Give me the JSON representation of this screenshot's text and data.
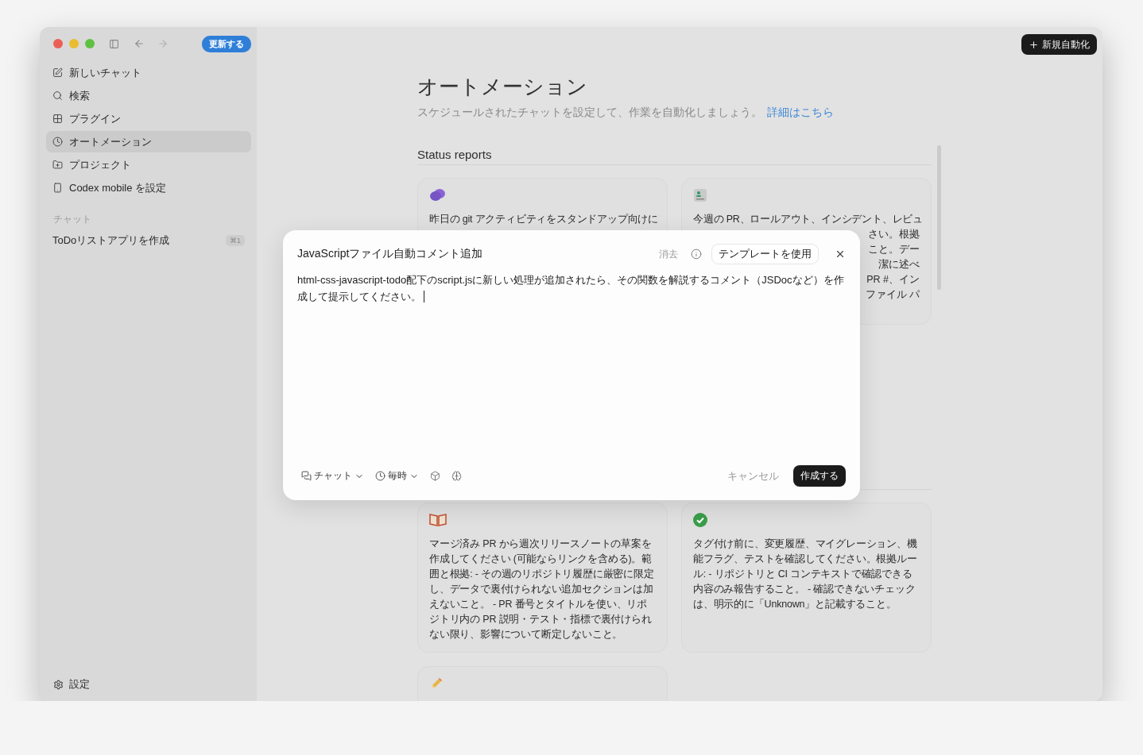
{
  "window": {
    "update_button": "更新する",
    "new_automation_button": "新規自動化"
  },
  "sidebar": {
    "items": [
      {
        "kind": "edit",
        "label": "新しいチャット",
        "selected": false
      },
      {
        "kind": "search",
        "label": "検索",
        "selected": false
      },
      {
        "kind": "plugins",
        "label": "プラグイン",
        "selected": false
      },
      {
        "kind": "automation",
        "label": "オートメーション",
        "selected": true
      },
      {
        "kind": "project",
        "label": "プロジェクト",
        "selected": false
      },
      {
        "kind": "mobile",
        "label": "Codex mobile を設定",
        "selected": false
      }
    ],
    "section": "チャット",
    "chats": [
      {
        "label": "ToDoリストアプリを作成",
        "shortcut": "⌘1"
      }
    ],
    "settings": "設定"
  },
  "page": {
    "title": "オートメーション",
    "subtitle": "スケジュールされたチャットを設定して、作業を自動化しましょう。",
    "link": "詳細はこちら"
  },
  "sections": [
    {
      "heading": "Status reports",
      "cards": [
        {
          "kind": "standup",
          "text": "昨日の git アクティビティをスタンドアップ向けに"
        },
        {
          "kind": "weekly",
          "text": "今週の PR、ロールアウト、インシデント、レビュ",
          "fragments": [
            "さい。根拠",
            "こと。デー",
            "潔に述べ",
            "PR #、イン",
            "ファイル パ"
          ]
        }
      ]
    },
    {
      "cards": [
        {
          "kind": "notes",
          "text": "マージ済み PR から週次リリースノートの草案を作成してください (可能ならリンクを含める)。範囲と根拠: - その週のリポジトリ履歴に厳密に限定し、データで裏付けられない追加セクションは加えないこと。 - PR 番号とタイトルを使い、リポジトリ内の PR 説明・テスト・指標で裏付けられない限り、影響について断定しないこと。"
        },
        {
          "kind": "release",
          "text": "タグ付け前に、変更履歴、マイグレーション、機能フラグ、テストを確認してください。根拠ルール: - リポジトリと CI コンテキストで確認できる内容のみ報告すること。 - 確認できないチェックは、明示的に「Unknown」と記載すること。"
        },
        {
          "kind": "draft"
        }
      ]
    }
  ],
  "dialog": {
    "title": "JavaScriptファイル自動コメント追加",
    "clear": "消去",
    "template_button": "テンプレートを使用",
    "prompt": "html-css-javascript-todo配下のscript.jsに新しい処理が追加されたら、その関数を解説するコメント（JSDocなど）を作成して提示してください。",
    "mode": "チャット",
    "schedule": "毎時",
    "cancel": "キャンセル",
    "create": "作成する"
  }
}
